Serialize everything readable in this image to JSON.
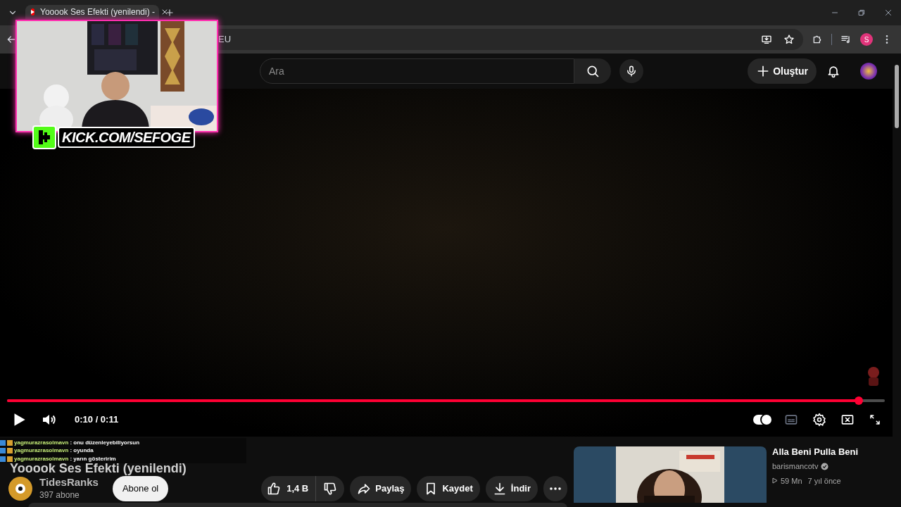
{
  "browser": {
    "tab": {
      "title": "Yooook Ses Efekti (yenilendi) - "
    },
    "address": "EU",
    "profile_initial": "S"
  },
  "header": {
    "search": {
      "placeholder": "Ara"
    },
    "create_label": "Oluştur"
  },
  "player": {
    "progress": {
      "level": 0.97
    },
    "time": "0:10 / 0:11",
    "autoplay": {
      "on": true
    }
  },
  "video": {
    "title": "Yooook Ses Efekti (yenilendi)",
    "channel": "TidesRanks",
    "subscribers": "397 abone",
    "subscribe": "Abone ol",
    "likes": "1,4 B",
    "actions": [
      {
        "kind": "share",
        "label": "Paylaş"
      },
      {
        "kind": "save",
        "label": "Kaydet"
      },
      {
        "kind": "download",
        "label": "İndir"
      }
    ]
  },
  "recommendation": {
    "title": "Alla Beni Pulla Beni",
    "channel": "barismancotv",
    "verified": true,
    "views": "59 Mn",
    "age": "7 yıl önce"
  },
  "overlay": {
    "webcam_caption": "KICK.COM/SEFOGE",
    "chat": [
      {
        "user": "yagmurazrasolmavn",
        "message": ": onu düzenleyebiliyorsun"
      },
      {
        "user": "yagmurazrasolmavn",
        "message": ": oyunda"
      },
      {
        "user": "yagmurazrasolmavn",
        "message": ": yarın gösteririm"
      }
    ]
  }
}
